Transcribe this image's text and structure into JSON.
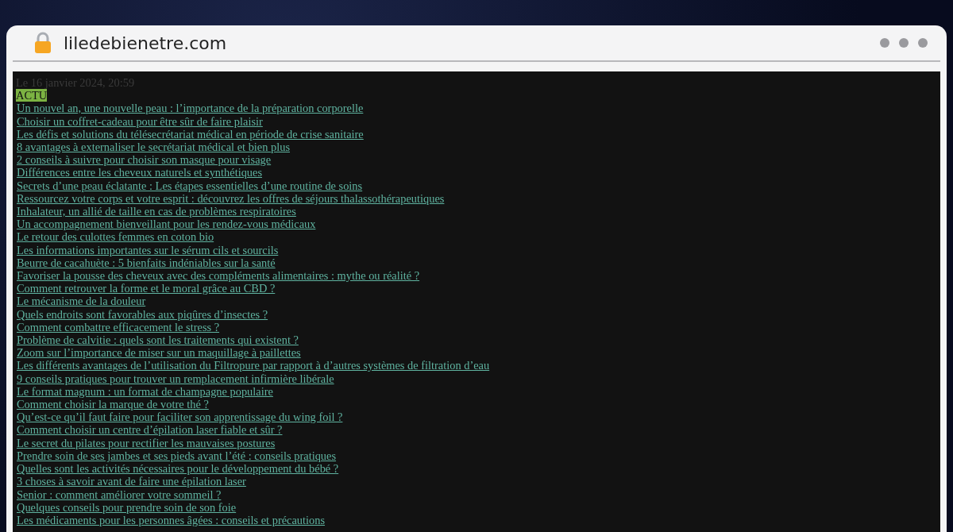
{
  "browser": {
    "url": "liledebienetre.com"
  },
  "page": {
    "date": "Le 16 janvier 2024, 20:59",
    "category": "ACTU",
    "links": [
      "Un nouvel an, une nouvelle peau : l’importance de la préparation corporelle",
      "Choisir un coffret-cadeau pour être sûr de faire plaisir",
      "Les défis et solutions du télésecrétariat médical en période de crise sanitaire",
      "8 avantages à externaliser le secrétariat médical et bien plus",
      "2 conseils à suivre pour choisir son masque pour visage",
      "Différences entre les cheveux naturels et synthétiques",
      "Secrets d’une peau éclatante : Les étapes essentielles d’une routine de soins",
      "Ressourcez votre corps et votre esprit : découvrez les offres de séjours thalassothérapeutiques",
      "Inhalateur, un allié de taille en cas de problèmes respiratoires",
      "Un accompagnement bienveillant pour les rendez-vous médicaux",
      "Le retour des culottes femmes en coton bio",
      "Les informations importantes sur le sérum cils et sourcils",
      "Beurre de cacahuète : 5 bienfaits indéniables sur la santé",
      "Favoriser la pousse des cheveux avec des compléments alimentaires : mythe ou réalité ?",
      "Comment retrouver la forme et le moral grâce au CBD ?",
      "Le mécanisme de la douleur",
      "Quels endroits sont favorables aux piqûres d’insectes ?",
      "Comment combattre efficacement le stress ?",
      "Problème de calvitie : quels sont les traitements qui existent ?",
      "Zoom sur l’importance de miser sur un maquillage à paillettes",
      "Les différents avantages de l’utilisation du Filtropure par rapport à d’autres systèmes de filtration d’eau",
      "9 conseils pratiques pour trouver un remplacement infirmière libérale",
      "Le format magnum : un format de champagne populaire",
      "Comment choisir la marque de votre thé ?",
      "Qu’est-ce qu’il faut faire pour faciliter son apprentissage du wing foil ?",
      "Comment choisir un centre d’épilation laser fiable et sûr ?",
      "Le secret du pilates pour rectifier les mauvaises postures",
      "Prendre soin de ses jambes et ses pieds avant l’été : conseils pratiques",
      "Quelles sont les activités nécessaires pour le développement du bébé ?",
      "3 choses à savoir avant de faire une épilation laser",
      "Senior : comment améliorer votre sommeil ?",
      "Quelques conseils pour prendre soin de son foie",
      "Les médicaments pour les personnes âgées : conseils et précautions"
    ]
  }
}
